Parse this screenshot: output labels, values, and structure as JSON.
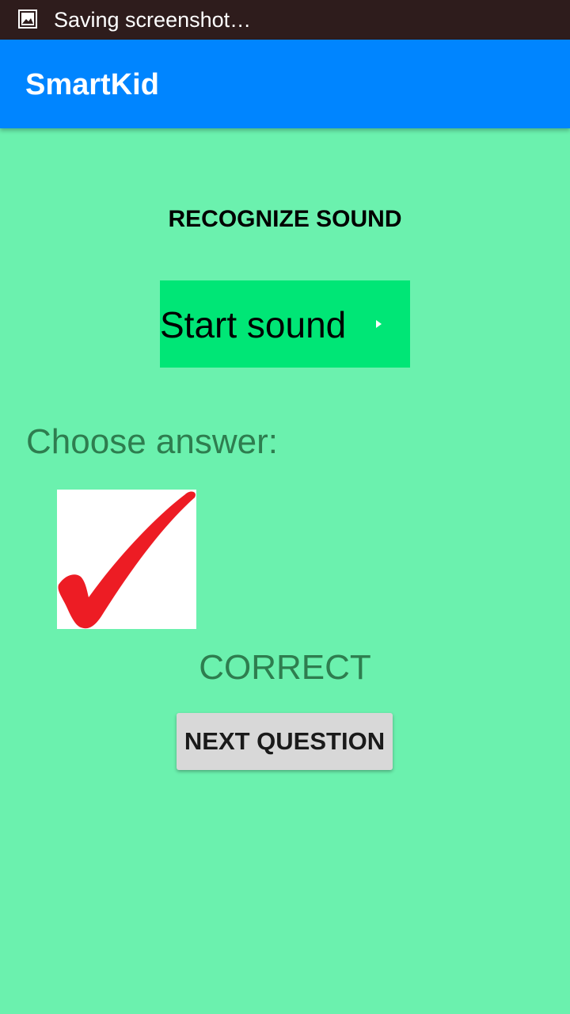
{
  "status_bar": {
    "notification_icon": "image-icon",
    "text": "Saving screenshot…"
  },
  "app_bar": {
    "title": "SmartKid",
    "color": "#0085ff"
  },
  "main": {
    "heading": "RECOGNIZE SOUND",
    "start_sound_label": "Start sound",
    "play_icon": "play-icon",
    "choose_label": "Choose answer:",
    "answer_image": "checkmark-icon",
    "result": "CORRECT",
    "next_button_label": "NEXT QUESTION"
  },
  "colors": {
    "background": "#6bf1ae",
    "start_button": "#00e676",
    "checkmark": "#ed1c24",
    "label_text": "#2e7d4f"
  }
}
